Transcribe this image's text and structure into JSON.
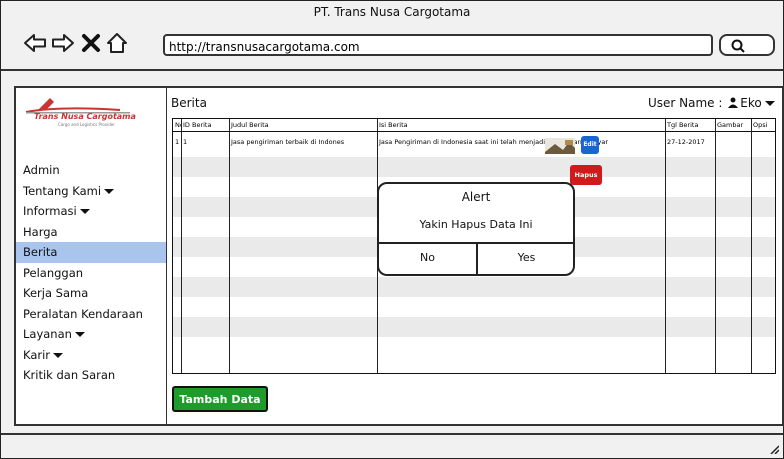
{
  "window": {
    "title": "PT. Trans Nusa Cargotama"
  },
  "browser": {
    "url": "http://transnusacargotama.com"
  },
  "logo": {
    "text": "Trans Nusa Cargotama",
    "subtext": "Cargo and Logistics Provider"
  },
  "sidebar": {
    "items": [
      {
        "label": "Admin",
        "dropdown": false
      },
      {
        "label": "Tentang Kami",
        "dropdown": true
      },
      {
        "label": "Informasi",
        "dropdown": true
      },
      {
        "label": "Harga",
        "dropdown": false
      },
      {
        "label": "Berita",
        "dropdown": false,
        "active": true
      },
      {
        "label": "Pelanggan",
        "dropdown": false
      },
      {
        "label": "Kerja Sama",
        "dropdown": false
      },
      {
        "label": "Peralatan Kendaraan",
        "dropdown": false
      },
      {
        "label": "Layanan",
        "dropdown": true
      },
      {
        "label": "Karir",
        "dropdown": true
      },
      {
        "label": "Kritik dan Saran",
        "dropdown": false
      }
    ]
  },
  "page": {
    "title": "Berita",
    "user_label": "User Name :",
    "user_name": "Eko"
  },
  "table": {
    "headers": [
      "No",
      "ID Berita",
      "Judul Berita",
      "Isi Berita",
      "Tgl Berita",
      "Gambar",
      "Opsi"
    ],
    "rows": [
      {
        "no": "1",
        "id": "1",
        "judul": "Jasa pengiriman terbaik di Indones",
        "isi": "Jasa Pengiriman di Indonesia saat ini telah menjadi kebutuhan masyar",
        "tgl": "27-12-2017"
      }
    ],
    "edit_label": "Edit",
    "hapus_label": "Hapus"
  },
  "alert": {
    "title": "Alert",
    "message": "Yakin Hapus Data Ini",
    "no_label": "No",
    "yes_label": "Yes"
  },
  "actions": {
    "add_label": "Tambah Data"
  },
  "colors": {
    "active_menu": "#a9c5ee",
    "edit": "#1866d4",
    "hapus": "#cf1b1b",
    "tambah": "#1e9b2b"
  }
}
